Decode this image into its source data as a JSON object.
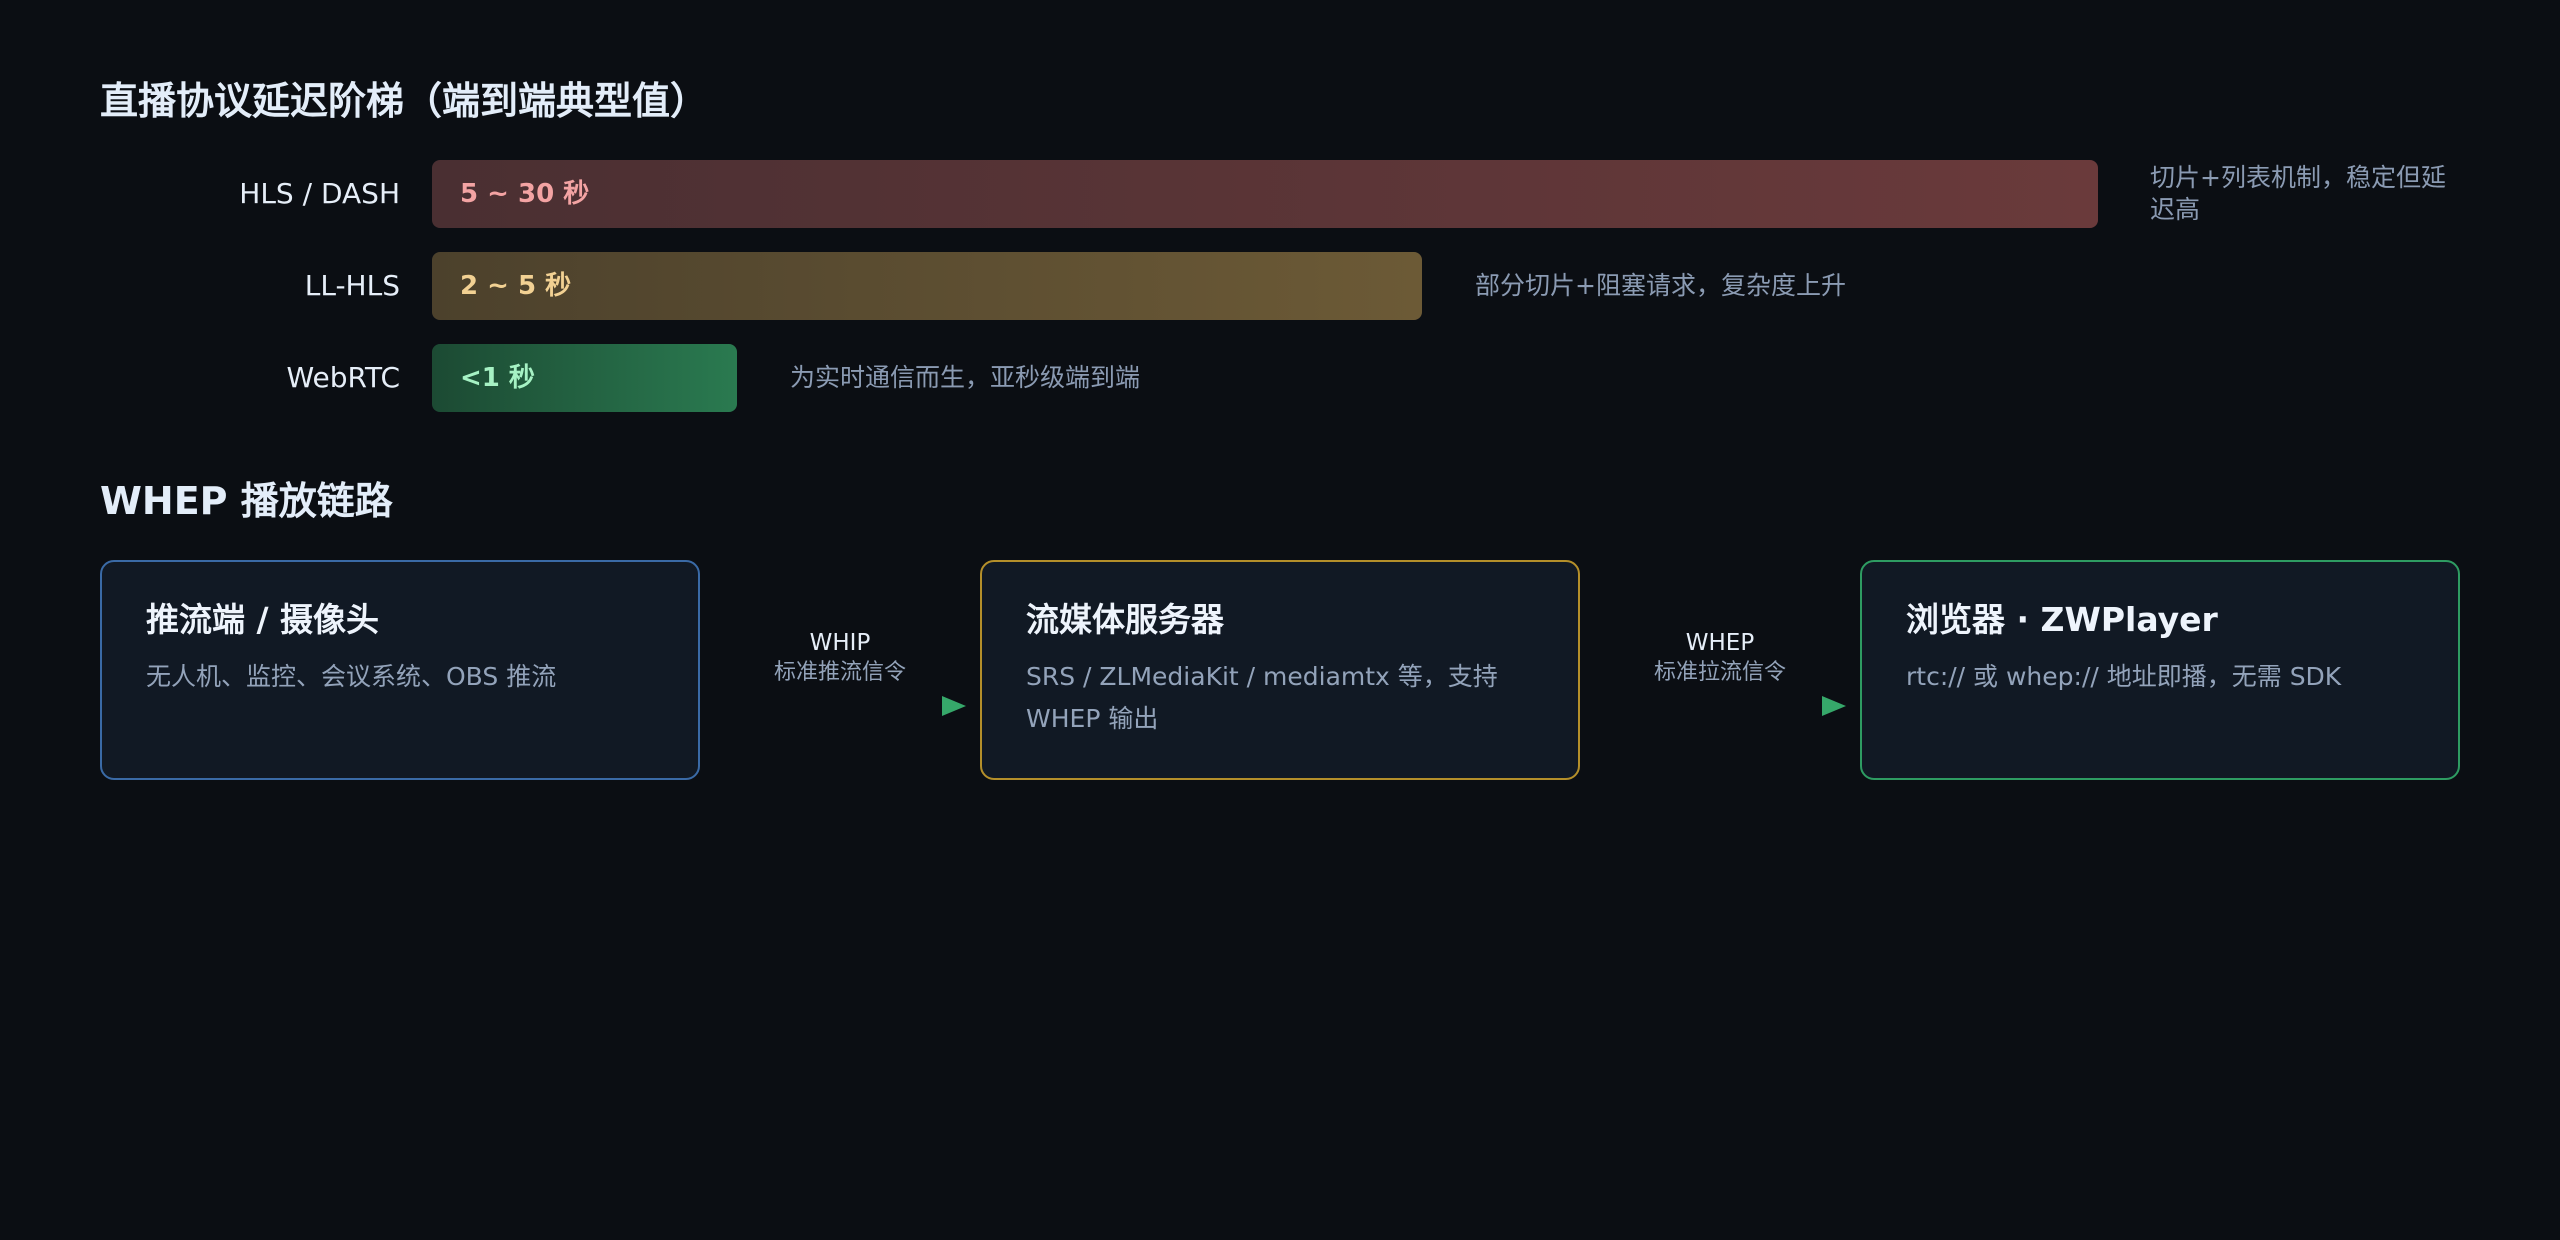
{
  "latency_ladder": {
    "title": "直播协议延迟阶梯（端到端典型值）",
    "rows": [
      {
        "protocol": "HLS / DASH",
        "value": "5 ~ 30 秒",
        "note": "切片+列表机制，稳定但延迟高",
        "color": "#6a3a3b"
      },
      {
        "protocol": "LL-HLS",
        "value": "2 ~ 5 秒",
        "note": "部分切片+阻塞请求，复杂度上升",
        "color": "#6c5a36"
      },
      {
        "protocol": "WebRTC",
        "value": "<1 秒",
        "note": "为实时通信而生，亚秒级端到端",
        "color": "#2a7a50"
      }
    ]
  },
  "whep_flow": {
    "title": "WHEP 播放链路",
    "nodes": [
      {
        "title": "推流端 / 摄像头",
        "desc": "无人机、监控、会议系统、OBS 推流",
        "border_color": "#3a6aa6"
      },
      {
        "title": "流媒体服务器",
        "desc": "SRS / ZLMediaKit / mediamtx 等，支持 WHEP 输出",
        "border_color": "#b48f2a"
      },
      {
        "title": "浏览器 · ZWPlayer",
        "desc": "rtc:// 或 whep:// 地址即播，无需 SDK",
        "border_color": "#2e9c62"
      }
    ],
    "connectors": [
      {
        "protocol": "WHIP",
        "desc": "标准推流信令"
      },
      {
        "protocol": "WHEP",
        "desc": "标准拉流信令"
      }
    ],
    "arrow_gradient": [
      "#3a6aa6",
      "#2e9c62"
    ]
  }
}
